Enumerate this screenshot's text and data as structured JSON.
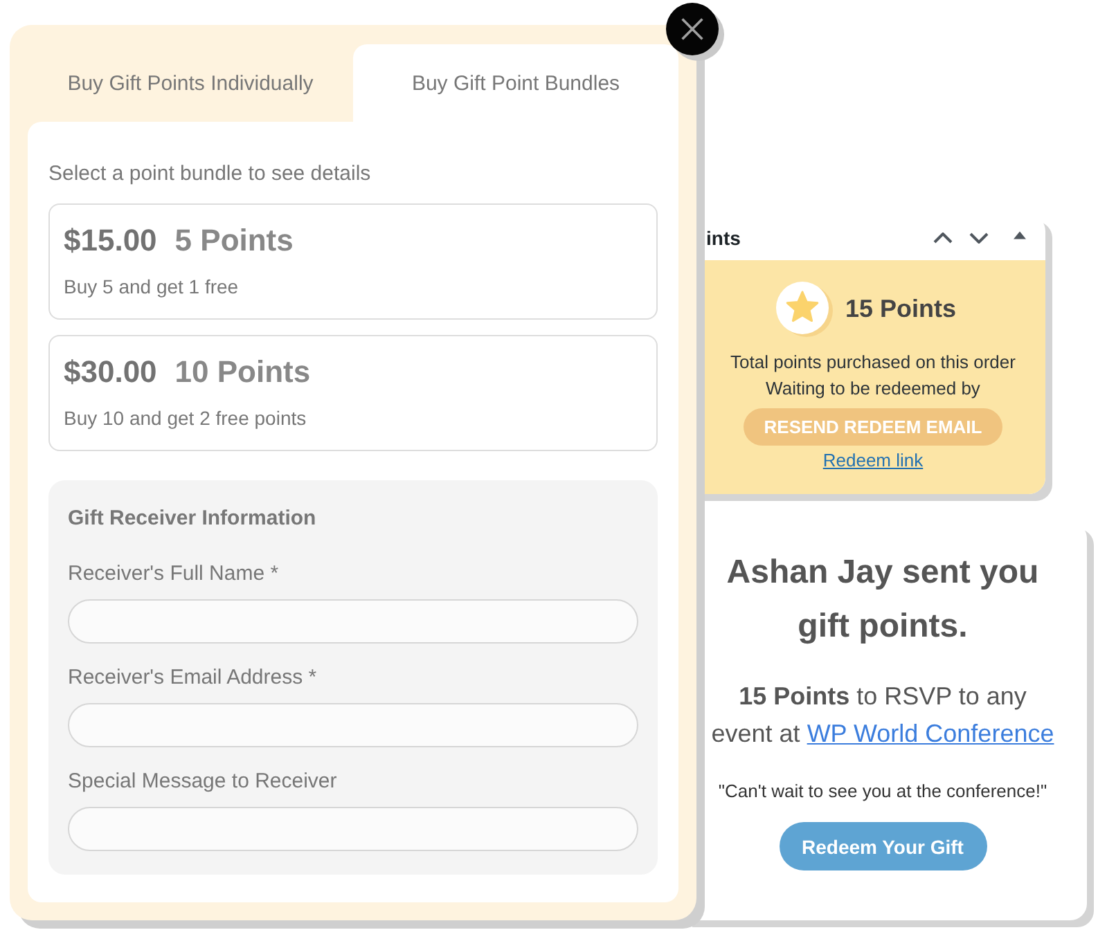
{
  "modal": {
    "tabs": [
      {
        "label": "Buy Gift Points Individually",
        "selected": false
      },
      {
        "label": "Buy Gift Point Bundles",
        "selected": true
      }
    ],
    "instruction": "Select a point bundle to see details",
    "bundles": [
      {
        "price": "$15.00",
        "points": "5 Points",
        "description": "Buy 5 and get 1 free"
      },
      {
        "price": "$30.00",
        "points": "10 Points",
        "description": "Buy 10 and get 2 free points"
      }
    ],
    "receiver_form": {
      "title": "Gift Receiver Information",
      "fields": [
        {
          "label": "Receiver's Full Name *"
        },
        {
          "label": "Receiver's Email Address *"
        },
        {
          "label": "Special Message to Receiver"
        }
      ]
    }
  },
  "points_panel": {
    "title": "ints",
    "points": "15 Points",
    "summary": "Total points purchased on this order",
    "status": "Waiting to be redeemed by",
    "resend_button": "RESEND REDEEM EMAIL",
    "redeem_link": "Redeem link"
  },
  "gift_email": {
    "heading": "Ashan Jay sent you gift points.",
    "message": "**15 Points** to RSVP to any event at ",
    "link": "WP World Conference",
    "quote": "\"Can't wait to see you at the conference!\"",
    "button": "Redeem Your Gift"
  }
}
